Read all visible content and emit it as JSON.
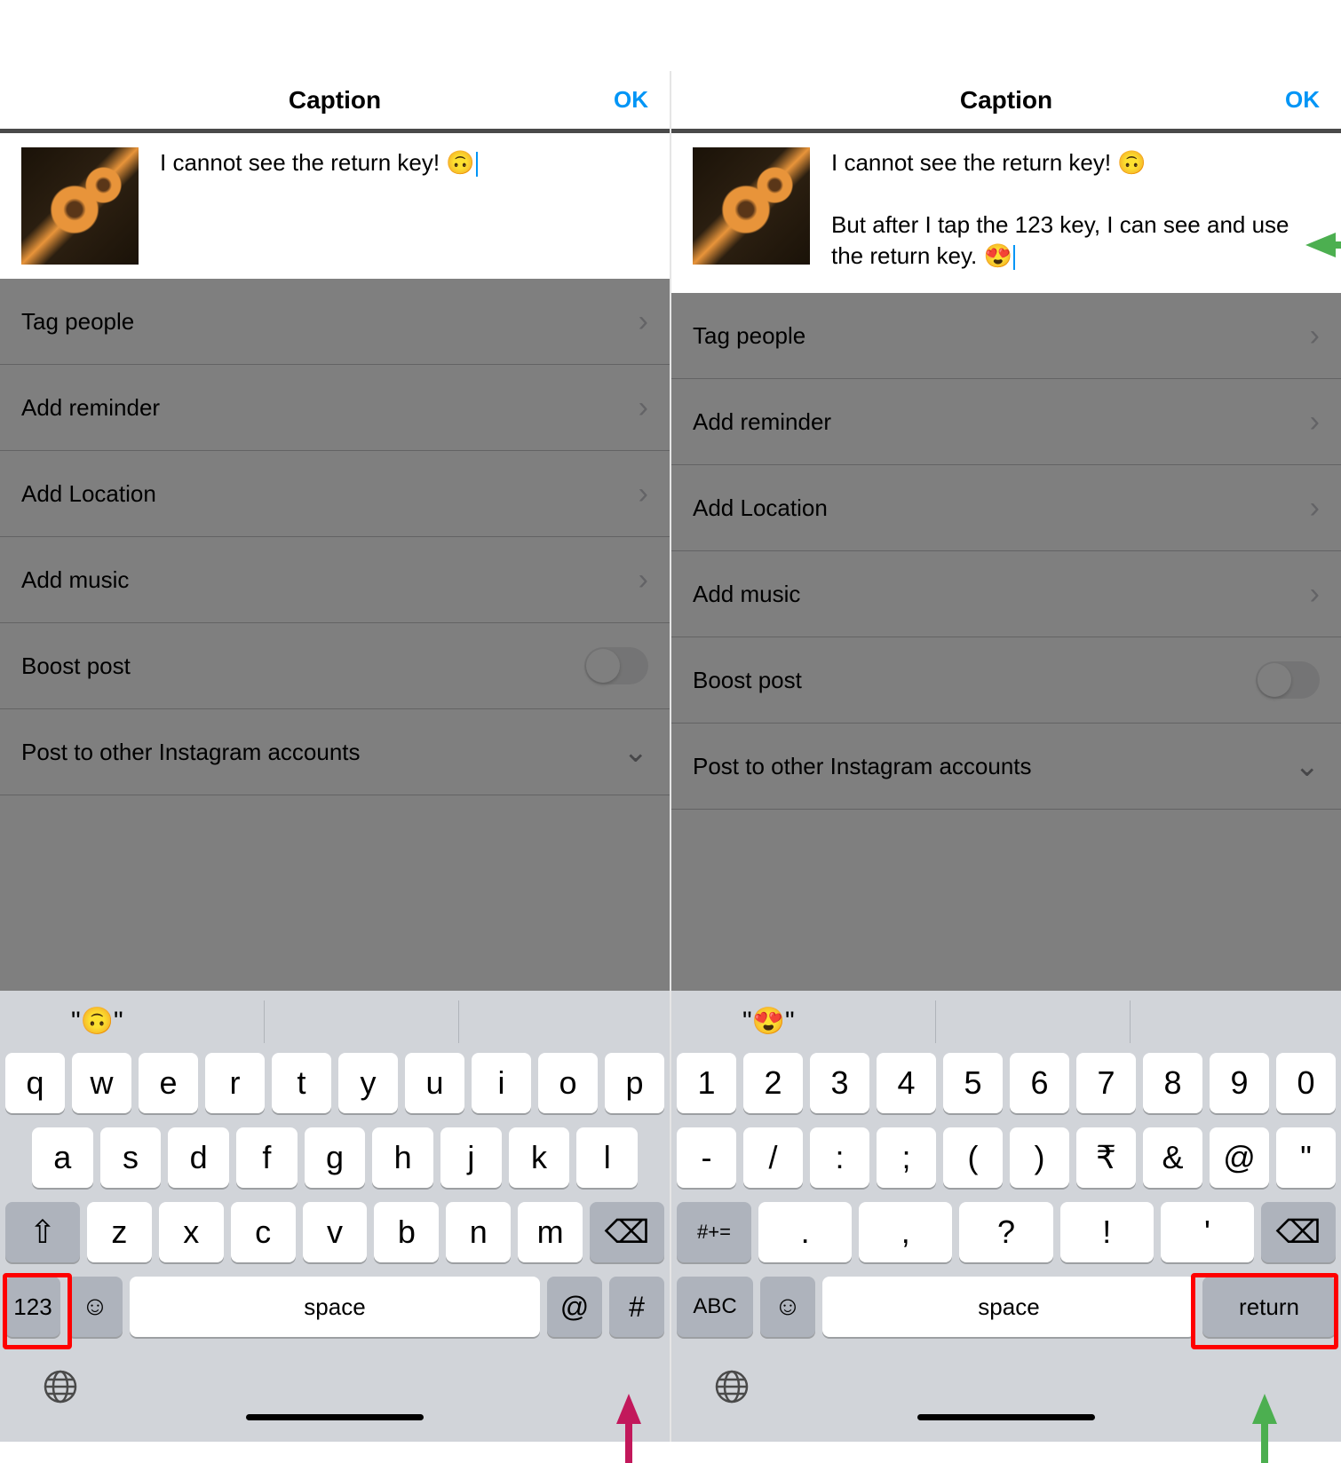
{
  "left": {
    "header": {
      "title": "Caption",
      "ok": "OK"
    },
    "caption": "I cannot see the return key! 🙃",
    "options": [
      {
        "label": "Tag people",
        "accessory": "chevron"
      },
      {
        "label": "Add reminder",
        "accessory": "chevron"
      },
      {
        "label": "Add Location",
        "accessory": "chevron"
      },
      {
        "label": "Add music",
        "accessory": "chevron"
      },
      {
        "label": "Boost post",
        "accessory": "toggle"
      },
      {
        "label": "Post to other Instagram accounts",
        "accessory": "chevron-down"
      }
    ],
    "keyboard": {
      "suggestion": "\"🙃\"",
      "row1": [
        "q",
        "w",
        "e",
        "r",
        "t",
        "y",
        "u",
        "i",
        "o",
        "p"
      ],
      "row2": [
        "a",
        "s",
        "d",
        "f",
        "g",
        "h",
        "j",
        "k",
        "l"
      ],
      "row3": [
        "z",
        "x",
        "c",
        "v",
        "b",
        "n",
        "m"
      ],
      "shift": "⇧",
      "delete": "⌫",
      "switch": "123",
      "emoji": "☺",
      "space": "space",
      "at": "@",
      "hash": "#",
      "globe": "🌐"
    }
  },
  "right": {
    "header": {
      "title": "Caption",
      "ok": "OK"
    },
    "caption_line1": "I cannot see the return key! 🙃",
    "caption_line2": "But after I tap the 123 key, I can see and use the return key. 😍",
    "options": [
      {
        "label": "Tag people",
        "accessory": "chevron"
      },
      {
        "label": "Add reminder",
        "accessory": "chevron"
      },
      {
        "label": "Add Location",
        "accessory": "chevron"
      },
      {
        "label": "Add music",
        "accessory": "chevron"
      },
      {
        "label": "Boost post",
        "accessory": "toggle"
      },
      {
        "label": "Post to other Instagram accounts",
        "accessory": "chevron-down"
      }
    ],
    "keyboard": {
      "suggestion": "\"😍\"",
      "row1": [
        "1",
        "2",
        "3",
        "4",
        "5",
        "6",
        "7",
        "8",
        "9",
        "0"
      ],
      "row2": [
        "-",
        "/",
        ":",
        ";",
        "(",
        ")",
        "₹",
        "&",
        "@",
        "\""
      ],
      "row3": [
        ".",
        ",",
        "?",
        "!",
        "'"
      ],
      "sym": "#+=",
      "delete": "⌫",
      "switch": "ABC",
      "emoji": "☺",
      "space": "space",
      "return": "return",
      "globe": "🌐"
    }
  }
}
